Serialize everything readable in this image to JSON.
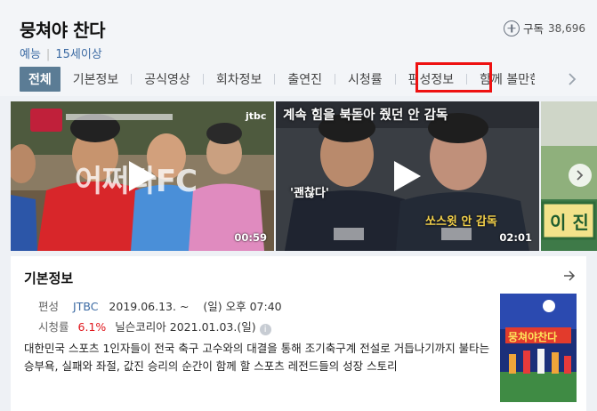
{
  "program": {
    "title": "뭉쳐야 찬다",
    "genre": "예능",
    "rating": "15세이상",
    "subscribe_label": "구독",
    "subscriber_count": "38,696"
  },
  "tabs": [
    {
      "label": "전체",
      "active": true
    },
    {
      "label": "기본정보",
      "active": false
    },
    {
      "label": "공식영상",
      "active": false
    },
    {
      "label": "회차정보",
      "active": false
    },
    {
      "label": "출연진",
      "active": false
    },
    {
      "label": "시청률",
      "active": false
    },
    {
      "label": "편성정보",
      "active": false,
      "highlighted": true
    },
    {
      "label": "함께 볼만한",
      "active": false
    }
  ],
  "videos": [
    {
      "duration": "00:59",
      "overlay_text": "어쩌다FC",
      "channel_badge": "jtbc"
    },
    {
      "duration": "02:01",
      "caption": "계속 힘을 북돋아 줬던 안 감독",
      "overlay_text_1": "'괜찮다'",
      "overlay_text_2": "쏘스윗 안 감독"
    },
    {
      "overlay_text": "이 진"
    }
  ],
  "info": {
    "section_title": "기본정보",
    "schedule_label": "편성",
    "channel": "JTBC",
    "start_date": "2019.06.13. ~",
    "airtime": "(일) 오후 07:40",
    "ratings_label": "시청률",
    "ratings_value": "6.1%",
    "ratings_source": "닐슨코리아",
    "ratings_date": "2021.01.03.(일)",
    "info_icon": "i",
    "description": "대한민국 스포츠 1인자들이 전국 축구 고수와의 대결을 통해 조기축구계 전설로 거듭나기까지 불타는 승부욕, 실패와 좌절, 값진 승리의 순간이 함께 할 스포츠 레전드들의 성장 스토리",
    "poster_text": "뭉쳐야찬다"
  },
  "colors": {
    "accent": "#5b7c95",
    "link": "#3b6aa3",
    "highlight_box": "#ee1111",
    "ratings_red": "#e0151b"
  }
}
